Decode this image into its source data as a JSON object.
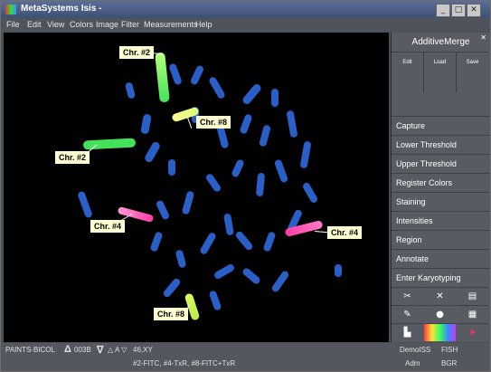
{
  "window": {
    "title": "MetaSystems Isis -"
  },
  "menu": [
    "File",
    "Edit",
    "View",
    "Colors",
    "Image",
    "Filter",
    "Measurements",
    "Help"
  ],
  "panel": {
    "title": "AdditiveMerge",
    "actions": [
      "Edit",
      "Load",
      "Save"
    ],
    "operations": [
      "Capture",
      "Lower Threshold",
      "Upper Threshold",
      "Register Colors",
      "Staining",
      "Intensities",
      "Region",
      "Annotate",
      "Enter Karyotyping"
    ],
    "tool_icons": [
      "scissors-icon",
      "chromosome-cut-icon",
      "layers-icon",
      "pin-icon",
      "circle-icon",
      "grid-icon",
      "histogram-icon",
      "spectrum-icon",
      "arrow-marker-icon"
    ]
  },
  "labels": [
    {
      "text": "Chr. #2"
    },
    {
      "text": "Chr. #8"
    },
    {
      "text": "Chr. #2"
    },
    {
      "text": "Chr. #4"
    },
    {
      "text": "Chr. #4"
    },
    {
      "text": "Chr. #8"
    }
  ],
  "status": {
    "mode": "PAINTS-BICOL",
    "delta_value": "003B",
    "delta_symbol": "Δ",
    "nabla_symbol": "∇",
    "triangle_symbols": "A",
    "karyotype": "46,XY",
    "probes": "#2-FITC, #4-TxR, #8-FITC+TxR",
    "lab": "DemoISS",
    "technique": "FISH",
    "user": "Adm",
    "color_scheme": "BGR"
  },
  "colors": {
    "chromosome_blue": "#2a5fc8",
    "fitc_green": "#42e35a",
    "txr_pink": "#ff3aa4",
    "yellow": "#e7f27a"
  }
}
